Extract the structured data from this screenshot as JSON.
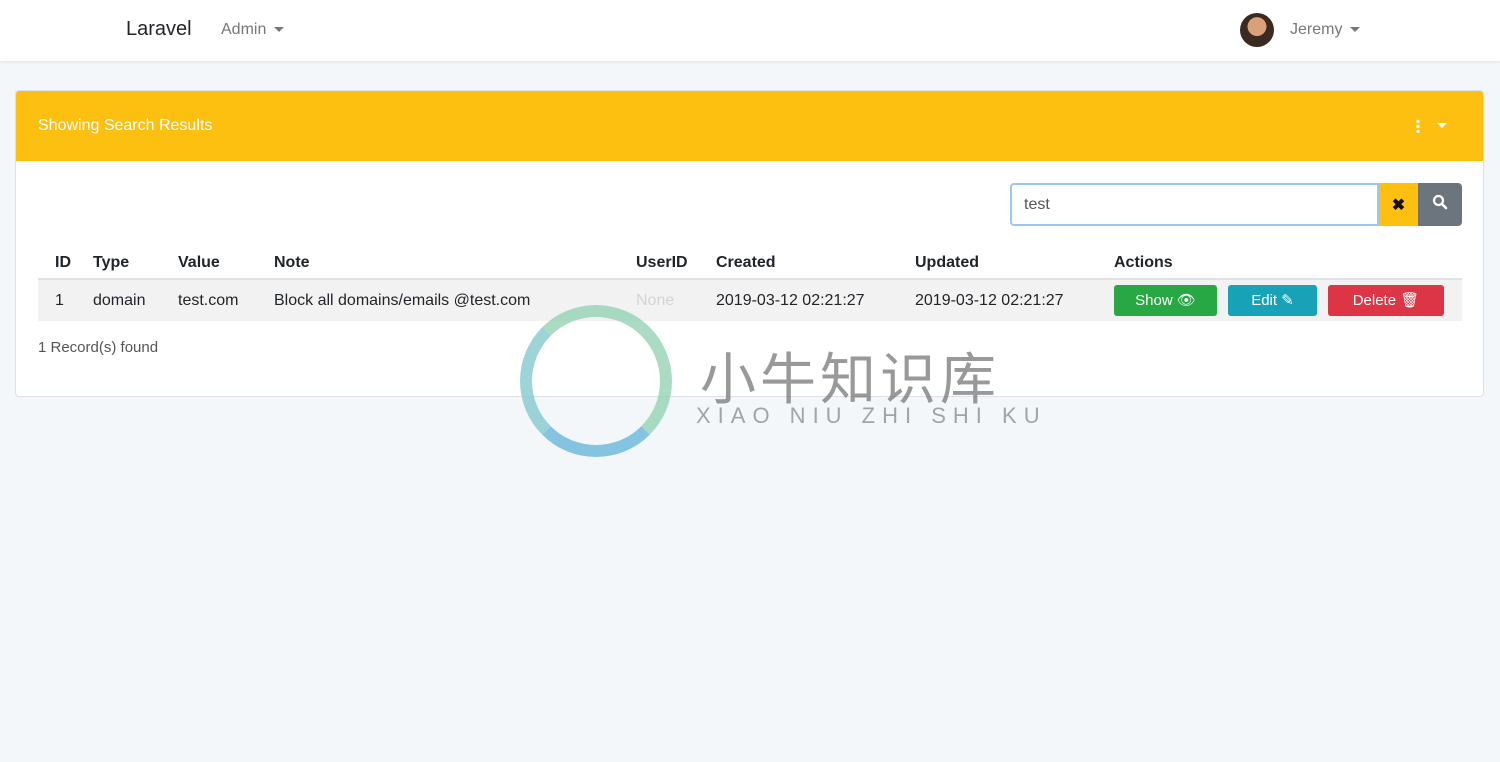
{
  "nav": {
    "brand": "Laravel",
    "admin_menu": "Admin",
    "user_menu": "Jeremy"
  },
  "card": {
    "title": "Showing Search Results"
  },
  "search": {
    "value": "test",
    "clear_icon": "close-icon",
    "search_icon": "search-icon"
  },
  "table": {
    "headers": [
      "ID",
      "Type",
      "Value",
      "Note",
      "UserID",
      "Created",
      "Updated",
      "Actions"
    ],
    "rows": [
      {
        "id": "1",
        "type": "domain",
        "value": "test.com",
        "note": "Block all domains/emails @test.com",
        "userid": "None",
        "created": "2019-03-12 02:21:27",
        "updated": "2019-03-12 02:21:27"
      }
    ],
    "actions": {
      "show": "Show",
      "edit": "Edit",
      "delete": "Delete"
    }
  },
  "count": "1 Record(s) found",
  "colors": {
    "warning": "#fdc010",
    "success": "#28a745",
    "info": "#17a2b8",
    "danger": "#dc3545",
    "secondary": "#6c757d"
  },
  "watermark": {
    "cn": "小牛知识库",
    "en": "XIAO NIU ZHI SHI KU"
  }
}
